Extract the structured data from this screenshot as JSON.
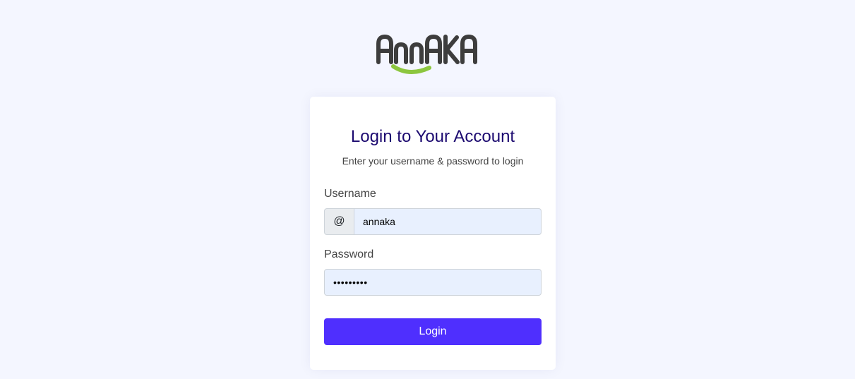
{
  "brand": {
    "logo_text": "AnnAKA",
    "text_color": "#3d3d3d",
    "smile_color": "#8cc63f"
  },
  "login": {
    "title": "Login to Your Account",
    "subtitle": "Enter your username & password to login",
    "username_label": "Username",
    "username_prefix": "@",
    "username_value": "annaka",
    "password_label": "Password",
    "password_value": "annaka123",
    "button_label": "Login"
  },
  "colors": {
    "background": "#f4f6ff",
    "title": "#1c0a70",
    "button": "#4f2ffe",
    "input_fill": "#e8f0fe"
  }
}
